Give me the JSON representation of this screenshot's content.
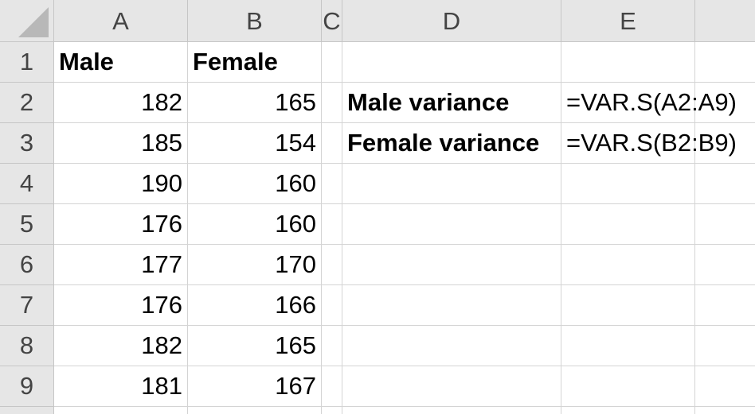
{
  "columns": [
    "A",
    "B",
    "C",
    "D",
    "E"
  ],
  "rows": [
    "1",
    "2",
    "3",
    "4",
    "5",
    "6",
    "7",
    "8",
    "9"
  ],
  "headers": {
    "male": "Male",
    "female": "Female"
  },
  "male_values": [
    "182",
    "185",
    "190",
    "176",
    "177",
    "176",
    "182",
    "181"
  ],
  "female_values": [
    "165",
    "154",
    "160",
    "160",
    "170",
    "166",
    "165",
    "167"
  ],
  "formulas": {
    "male_label": "Male variance",
    "male_formula": "=VAR.S(A2:A9)",
    "female_label": "Female variance",
    "female_formula": "=VAR.S(B2:B9)"
  },
  "colors": {
    "header_bg": "#e6e6e6",
    "grid_line": "#d4d4d4"
  }
}
